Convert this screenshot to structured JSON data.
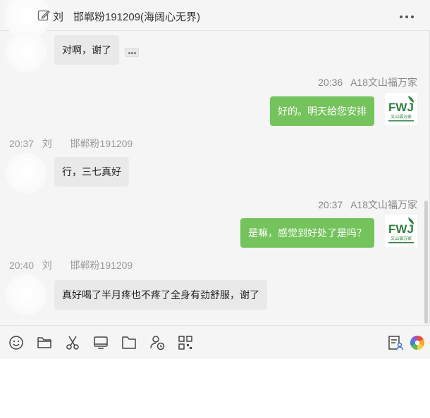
{
  "header": {
    "title_prefix": "刘",
    "title_rest": "邯郸粉191209(海阔心无界)",
    "more_icon": "more-horizontal-icon"
  },
  "messages": [
    {
      "direction": "in",
      "text": "对啊，谢了",
      "read_indicator": "more-dots-icon"
    },
    {
      "direction": "out",
      "time": "20:36",
      "sender": "A18文山福万家",
      "text": "好的。明天给您安排"
    },
    {
      "direction": "in",
      "time": "20:37",
      "sender_prefix": "刘",
      "sender_rest": "邯郸粉191209",
      "text": "行，三七真好"
    },
    {
      "direction": "out",
      "time": "20:37",
      "sender": "A18文山福万家",
      "text": "是嘛，感觉到好处了是吗？"
    },
    {
      "direction": "in",
      "time": "20:40",
      "sender_prefix": "刘",
      "sender_rest": "邯郸粉191209",
      "text": "真好喝了半月疼也不疼了全身有劲舒服，谢了"
    }
  ],
  "avatar_logo": {
    "letters": "FWJ",
    "caption": "文山福万家",
    "color": "#2e7d3e"
  },
  "toolbar": {
    "items": [
      "emoji-icon",
      "folder-icon",
      "scissors-icon",
      "screen-icon",
      "file-icon",
      "history-icon",
      "mini-program-icon"
    ],
    "right_items": [
      "document-user-icon",
      "color-wheel-icon"
    ]
  },
  "input": {
    "value": "",
    "placeholder": ""
  },
  "colors": {
    "out_bubble": "#75c35c",
    "in_bubble": "#e9e9e9",
    "background": "#f5f5f5"
  }
}
